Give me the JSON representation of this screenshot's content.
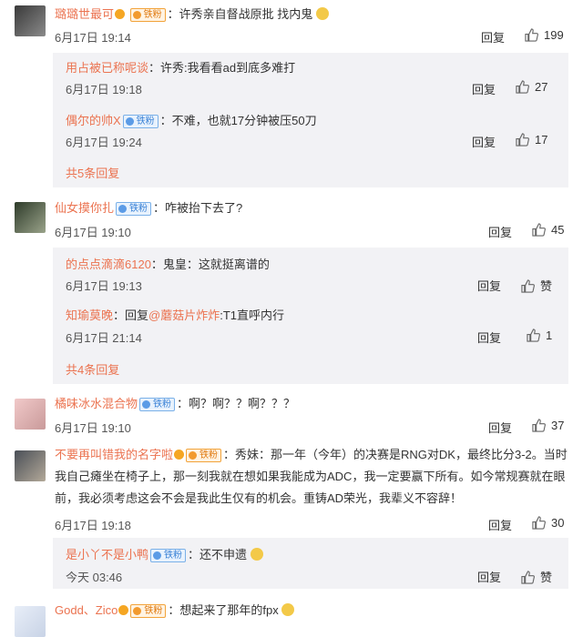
{
  "comments": [
    {
      "name": "璐璐世最可",
      "badge": "铁粉",
      "text": "：许秀亲自督战原批 找内鬼",
      "time": "6月17日 19:14",
      "reply": "回复",
      "likes": "199",
      "subs": [
        {
          "name": "用占被已称呢谈",
          "text": "：许秀:我看看ad到底多难打",
          "time": "6月17日 19:18",
          "reply": "回复",
          "likes": "27"
        },
        {
          "name": "偶尔的帅X",
          "badge": "铁粉",
          "text": "：不难，也就17分钟被压50刀",
          "time": "6月17日 19:24",
          "reply": "回复",
          "likes": "17"
        }
      ],
      "more": "共5条回复"
    },
    {
      "name": "仙女摸你扎",
      "badge": "铁粉",
      "text": "：咋被抬下去了?",
      "time": "6月17日 19:10",
      "reply": "回复",
      "likes": "45",
      "subs": [
        {
          "name": "的点点滴滴6120",
          "text": "：鬼皇：这就挺离谱的",
          "time": "6月17日 19:13",
          "reply": "回复",
          "likes": "赞"
        },
        {
          "name": "知瑜莫晚",
          "text": "：回复",
          "mention": "@蘑菇片炸炸",
          "text2": ":T1直呼内行",
          "time": "6月17日 21:14",
          "reply": "回复",
          "likes": "1"
        }
      ],
      "more": "共4条回复"
    },
    {
      "name": "橘味冰水混合物",
      "badge": "铁粉",
      "text": "：啊？啊？？啊？？？",
      "time": "6月17日 19:10",
      "reply": "回复",
      "likes": "37"
    },
    {
      "name": "不要再叫错我的名字啦",
      "badge": "铁粉",
      "text": "：秀妹：那一年（今年）的决赛是RNG对DK，最终比分3-2。当时我自己瘫坐在椅子上，那一刻我就在想如果我能成为ADC，我一定要赢下所有。如今常规赛就在眼前，我必须考虑这会不会是我此生仅有的机会。重铸AD荣光，我辈义不容辞！",
      "time": "6月17日 19:18",
      "reply": "回复",
      "likes": "30",
      "subs": [
        {
          "name": "是小丫不是小鸭",
          "badge": "铁粉",
          "text": "：还不申遗",
          "time": "今天 03:46",
          "reply": "回复",
          "likes": "赞"
        }
      ]
    },
    {
      "name": "Godd、Zico",
      "badge": "铁粉",
      "text": "：想起来了那年的fpx"
    }
  ],
  "colors": {
    "name": "#eb7350",
    "badge_blue": "#3a82d6",
    "badge_orange": "#e07a10",
    "subbox": "#f2f2f5"
  },
  "icons": {
    "like": "thumbs-up-icon",
    "vip": "vip-icon",
    "emoji": "emoji-icon"
  }
}
